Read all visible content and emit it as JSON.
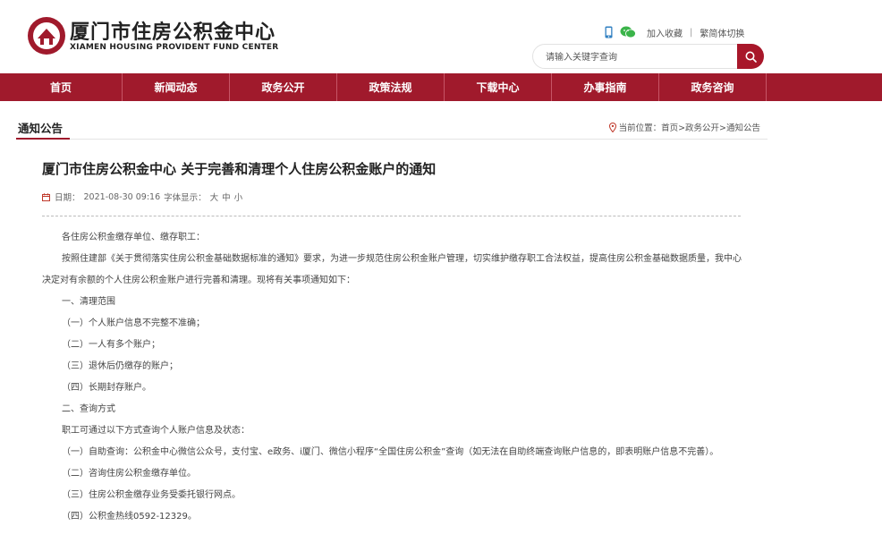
{
  "header": {
    "logo_cn": "厦门市住房公积金中心",
    "logo_en": "XIAMEN HOUSING PROVIDENT FUND CENTER",
    "icons": [
      "mobile-icon",
      "wechat-icon"
    ],
    "links": [
      "加入收藏",
      "繁简体切换"
    ],
    "search": {
      "placeholder": "请输入关键字查询"
    },
    "brand_color": "#a01a2c"
  },
  "nav": {
    "items": [
      "首页",
      "新闻动态",
      "政务公开",
      "政策法规",
      "下载中心",
      "办事指南",
      "政务咨询"
    ]
  },
  "breadcrumb": {
    "section": "通知公告",
    "label": "当前位置：",
    "path": "首页>政务公开>通知公告"
  },
  "article": {
    "title": "厦门市住房公积金中心 关于完善和清理个人住房公积金账户的通知",
    "date_label": "日期：",
    "date": "2021-08-30 09:16",
    "font_label": "字体显示：",
    "font_sizes": [
      "大",
      "中",
      "小"
    ],
    "paragraphs": [
      "各住房公积金缴存单位、缴存职工：",
      "按照住建部《关于贯彻落实住房公积金基础数据标准的通知》要求，为进一步规范住房公积金账户管理，切实维护缴存职工合法权益，提高住房公积金基础数据质量，我中心决定对有余额的个人住房公积金账户进行完善和清理。现将有关事项通知如下：",
      "一、清理范围",
      "（一）个人账户信息不完整不准确；",
      "（二）一人有多个账户；",
      "（三）退休后仍缴存的账户；",
      "（四）长期封存账户。",
      "二、查询方式",
      "职工可通过以下方式查询个人账户信息及状态：",
      "（一）自助查询：公积金中心微信公众号，支付宝、e政务、i厦门、微信小程序“全国住房公积金”查询（如无法在自助终端查询账户信息的，即表明账户信息不完善）。",
      "（二）咨询住房公积金缴存单位。",
      "（三）住房公积金缴存业务受委托银行网点。",
      "（四）公积金热线0592-12329。"
    ]
  }
}
